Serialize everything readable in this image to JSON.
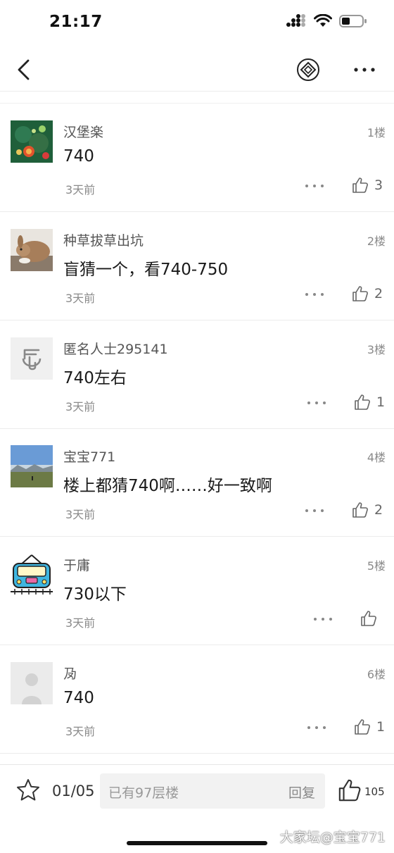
{
  "status_bar": {
    "time": "21:17"
  },
  "posts": [
    {
      "username": "汉堡楽",
      "floor": "1楼",
      "content": "740",
      "time": "3天前",
      "likes": "3",
      "avatar": "avatar-jewelry"
    },
    {
      "username": "种草拔草出坑",
      "floor": "2楼",
      "content": "盲猜一个，看740-750",
      "time": "3天前",
      "likes": "2",
      "avatar": "avatar-rabbit"
    },
    {
      "username": "匿名人士295141",
      "floor": "3楼",
      "content": "740左右",
      "time": "3天前",
      "likes": "1",
      "avatar": "avatar-anonymous-logo"
    },
    {
      "username": "宝宝771",
      "floor": "4楼",
      "content": "楼上都猜740啊……好一致啊",
      "time": "3天前",
      "likes": "2",
      "avatar": "avatar-landscape"
    },
    {
      "username": "于庸",
      "floor": "5楼",
      "content": "730以下",
      "time": "3天前",
      "likes": "",
      "avatar": "avatar-train"
    },
    {
      "username": "夃",
      "floor": "6楼",
      "content": "740",
      "time": "3天前",
      "likes": "1",
      "avatar": "avatar-default-person"
    }
  ],
  "bottom_bar": {
    "page": "01/05",
    "reply_placeholder": "已有97层楼",
    "reply_label": "回复",
    "like_count": "105"
  },
  "watermark": "大家坛@宝宝771",
  "colors": {
    "text_primary": "#1a1a1a",
    "text_secondary": "#8a8a8a",
    "divider": "#ececec",
    "input_bg": "#f2f2f2"
  }
}
